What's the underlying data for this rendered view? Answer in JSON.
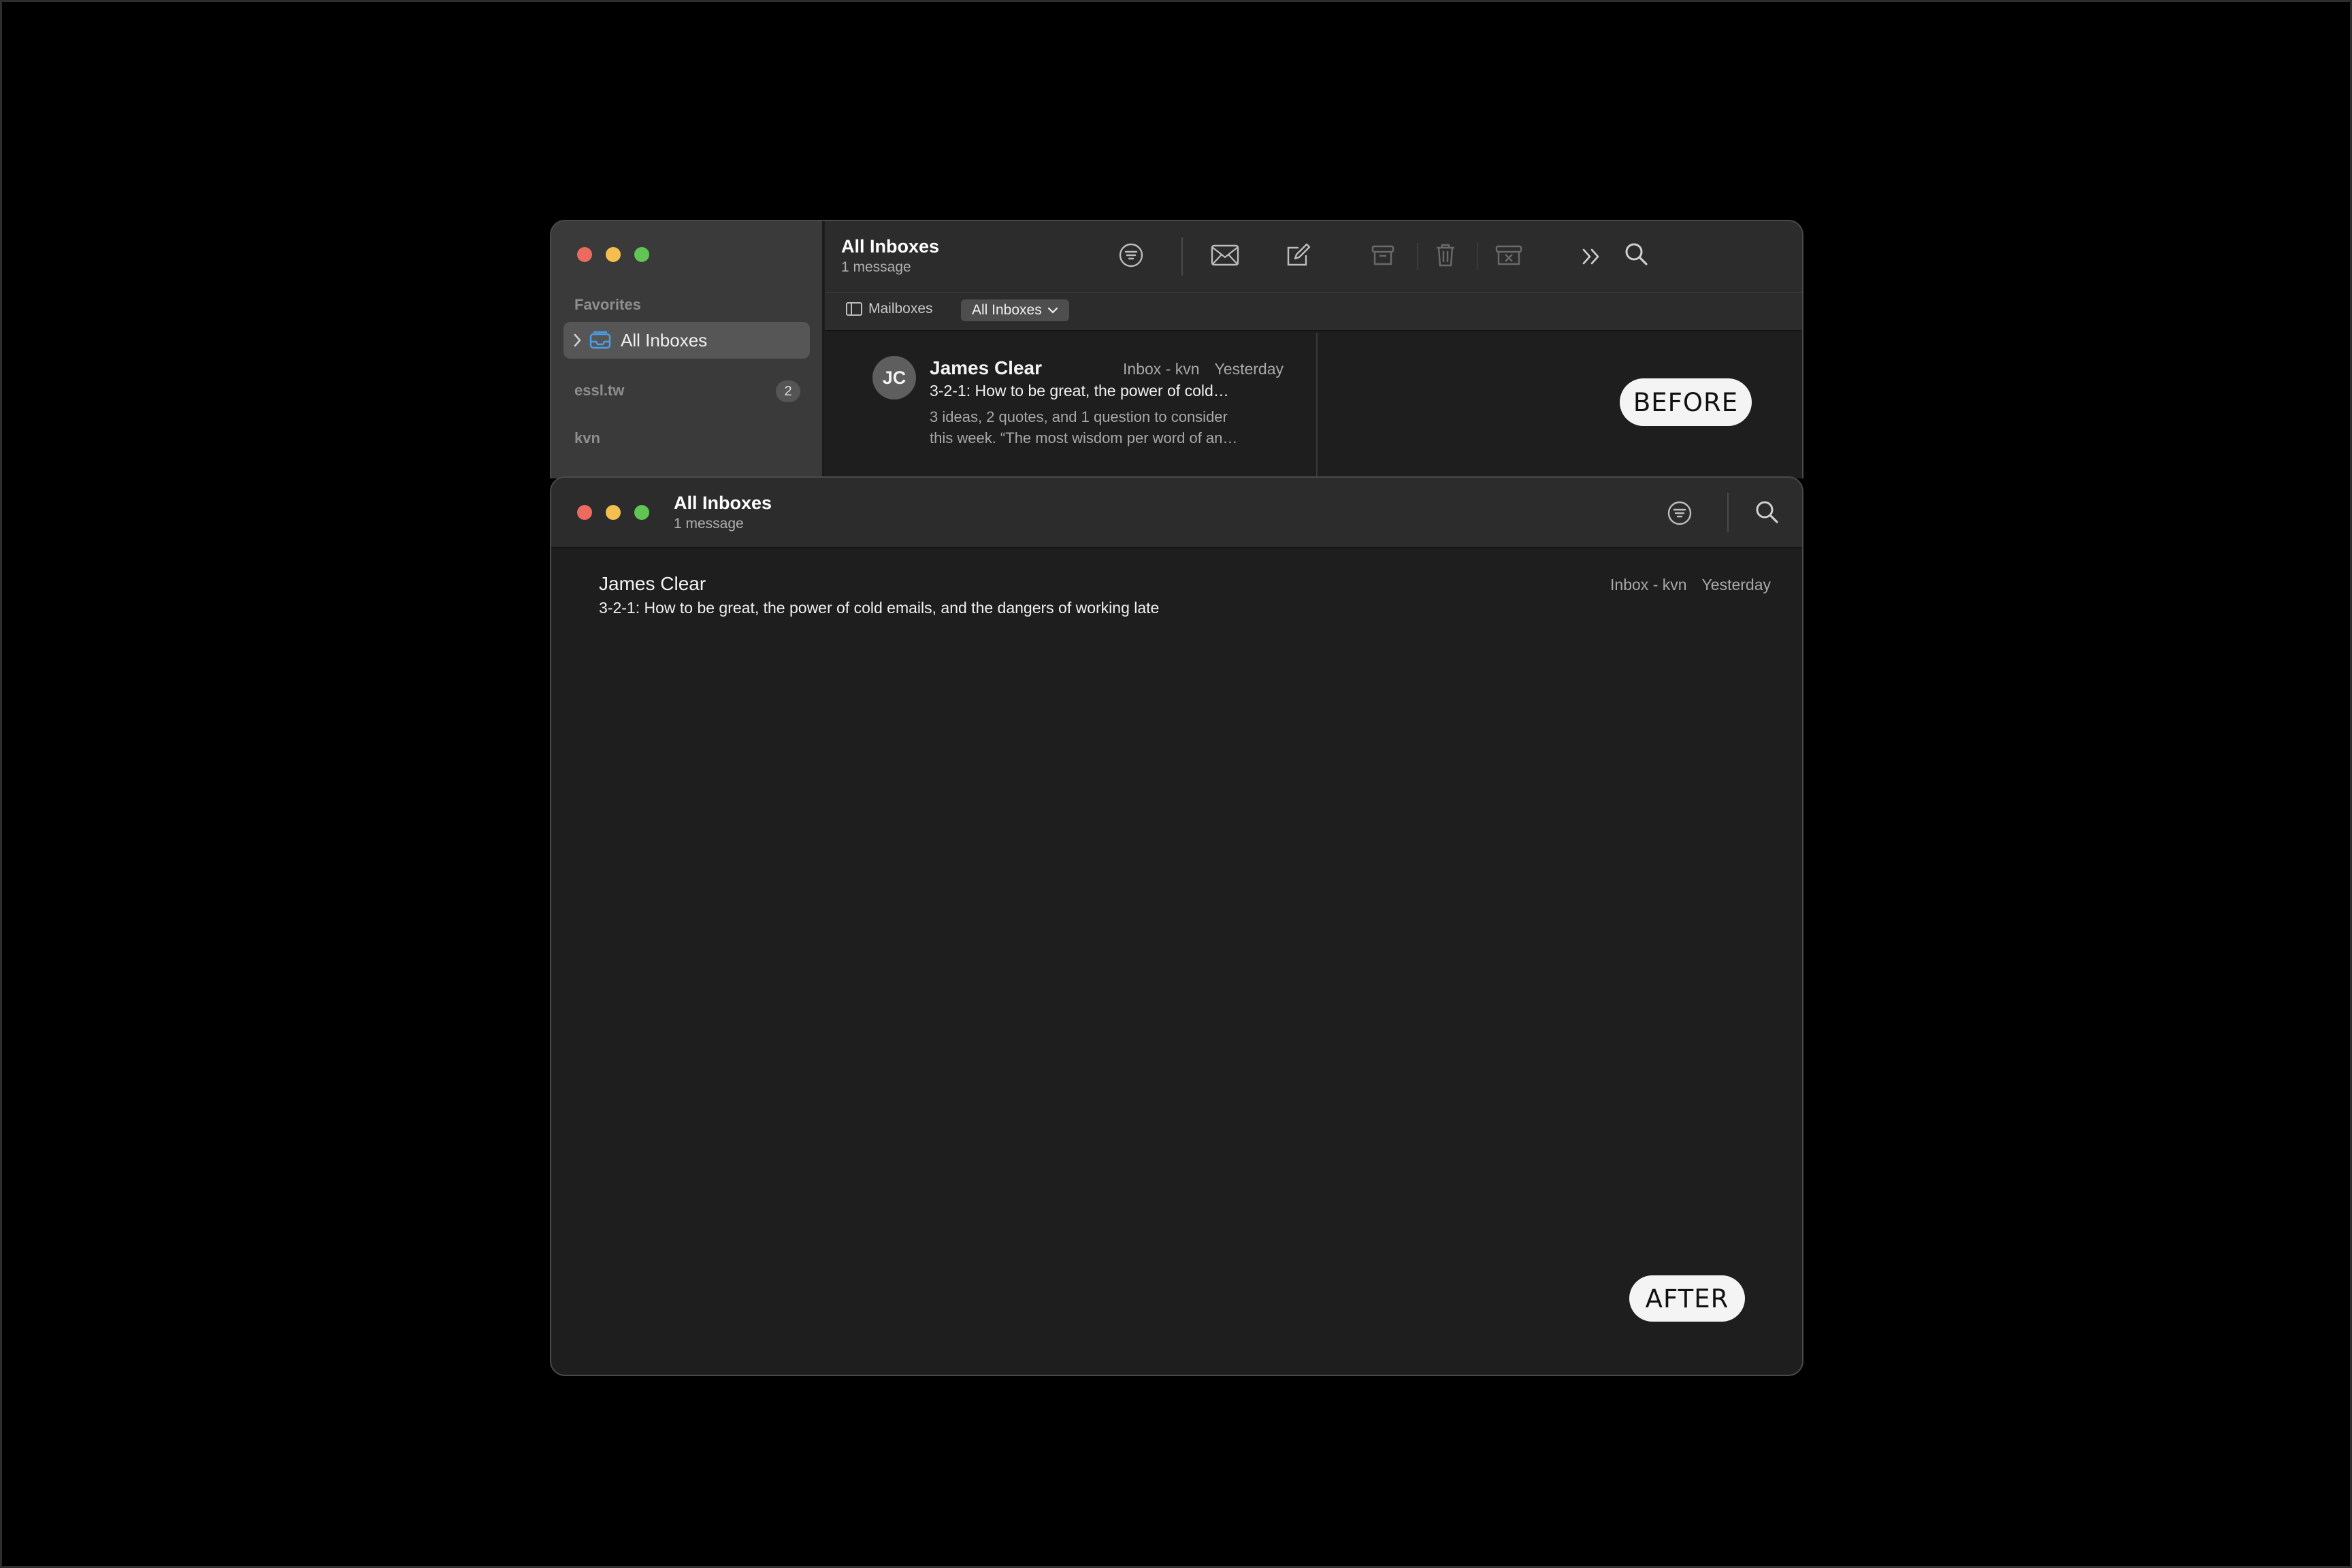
{
  "before_window": {
    "sidebar": {
      "section_favorites": "Favorites",
      "favorite_item": "All Inboxes",
      "account_1": "essl.tw",
      "account_1_badge": "2",
      "account_2": "kvn"
    },
    "toolbar": {
      "title": "All Inboxes",
      "subtitle": "1 message",
      "icons": [
        "filter-icon",
        "envelope-icon",
        "compose-icon",
        "archive-icon",
        "trash-icon",
        "junk-icon",
        "more-icon",
        "search-icon"
      ]
    },
    "filter_bar": {
      "mailboxes_label": "Mailboxes",
      "scope_label": "All Inboxes"
    },
    "message": {
      "avatar_initials": "JC",
      "sender": "James Clear",
      "mailbox": "Inbox - kvn",
      "date": "Yesterday",
      "subject": "3-2-1: How to be great, the power of cold…",
      "preview_line1": "3 ideas, 2 quotes, and 1 question to consider",
      "preview_line2": "this week. “The most wisdom per word of an…"
    },
    "label": "BEFORE"
  },
  "after_window": {
    "toolbar": {
      "title": "All Inboxes",
      "subtitle": "1 message"
    },
    "message": {
      "sender": "James Clear",
      "subject": "3-2-1: How to be great, the power of cold emails, and the dangers of working late",
      "mailbox": "Inbox - kvn",
      "date": "Yesterday"
    },
    "label": "AFTER"
  },
  "colors": {
    "background": "#000000",
    "sidebar": "#3a3a3a",
    "toolbar": "#2c2c2c",
    "content": "#1e1e1e",
    "traffic_red": "#ed6a5e",
    "traffic_yellow": "#f5bf4f",
    "traffic_green": "#61c554",
    "inbox_icon_blue": "#4a9fea"
  }
}
